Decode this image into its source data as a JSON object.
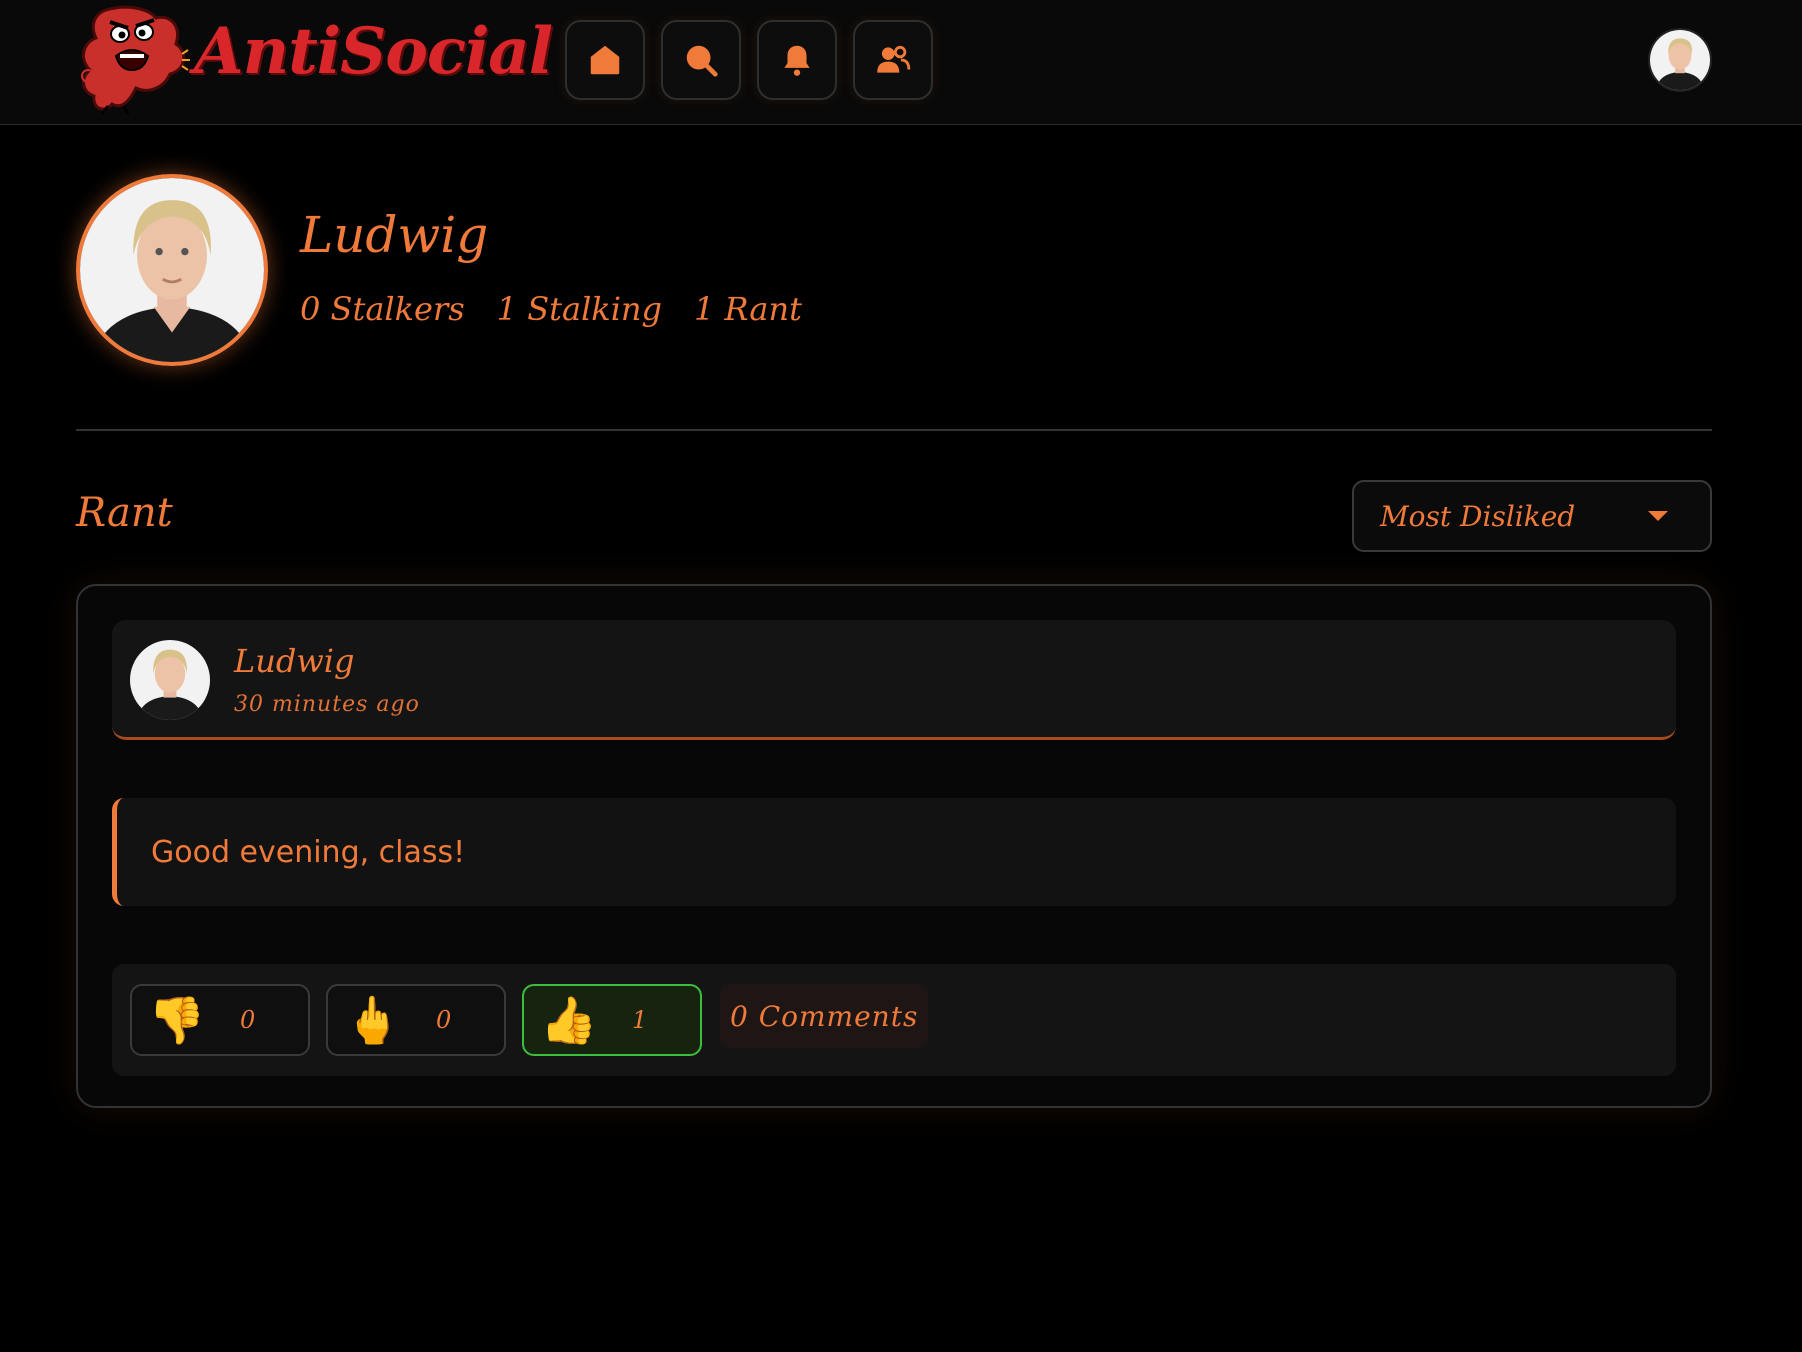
{
  "app": {
    "logo_text": "AntiSocial",
    "accent": "#f07a3a",
    "brand_red": "#d8262a"
  },
  "nav": {
    "items": [
      {
        "icon": "home-icon"
      },
      {
        "icon": "search-icon"
      },
      {
        "icon": "bell-icon"
      },
      {
        "icon": "users-icon"
      }
    ]
  },
  "profile": {
    "name": "Ludwig",
    "stats": {
      "stalkers": "0 Stalkers",
      "stalking": "1 Stalking",
      "rants": "1 Rant"
    }
  },
  "feed": {
    "section_title": "Rant",
    "sort": {
      "selected": "Most Disliked"
    }
  },
  "post": {
    "author": "Ludwig",
    "time": "30 minutes ago",
    "text": "Good evening, class!",
    "reactions": [
      {
        "name": "thumbs-down",
        "emoji": "👎",
        "count": "0"
      },
      {
        "name": "middle-finger",
        "emoji": "🖕",
        "count": "0"
      },
      {
        "name": "thumbs-up",
        "emoji": "👍",
        "count": "1",
        "active": true,
        "active_color": "#3cbf3c"
      }
    ],
    "comments_label": "0 Comments"
  }
}
